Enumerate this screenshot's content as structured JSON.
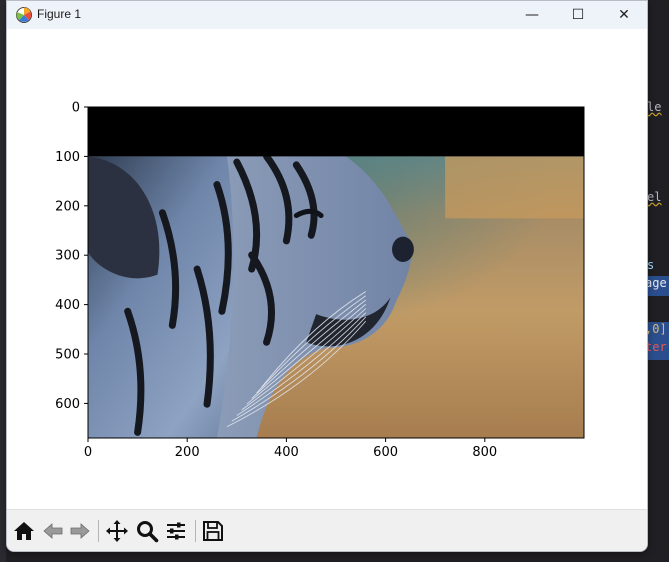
{
  "window": {
    "title": "Figure 1",
    "controls": {
      "minimize_symbol": "—",
      "maximize_symbol": "☐",
      "close_symbol": "✕"
    }
  },
  "background_editor": {
    "fragments": [
      "le",
      "el",
      "s",
      "age",
      ",0]",
      "ter"
    ]
  },
  "chart_data": {
    "type": "image",
    "title": "",
    "xlabel": "",
    "ylabel": "",
    "xlim": [
      0,
      1000
    ],
    "ylim": [
      670,
      0
    ],
    "x_ticks": [
      0,
      200,
      400,
      600,
      800
    ],
    "y_ticks": [
      0,
      100,
      200,
      300,
      400,
      500,
      600
    ],
    "image_extent": {
      "width": 1000,
      "height": 670
    },
    "black_band_rows": [
      0,
      100
    ],
    "image_subject": "tiger head in profile facing right, blue-grey fur with black stripes, blurred golden field background"
  },
  "toolbar": {
    "tools": [
      {
        "name": "home",
        "icon": "home-icon"
      },
      {
        "name": "back",
        "icon": "arrow-left-icon"
      },
      {
        "name": "forward",
        "icon": "arrow-right-icon"
      },
      {
        "name": "pan",
        "icon": "move-icon"
      },
      {
        "name": "zoom",
        "icon": "zoom-icon"
      },
      {
        "name": "configure",
        "icon": "sliders-icon"
      },
      {
        "name": "save",
        "icon": "save-icon"
      }
    ]
  },
  "colors": {
    "titlebar": "#eef2f9",
    "toolbar": "#f0f0f0",
    "plot_black_band": "#000000",
    "fur_blue": "#6e86ac",
    "background_gold": "#b9935e"
  }
}
